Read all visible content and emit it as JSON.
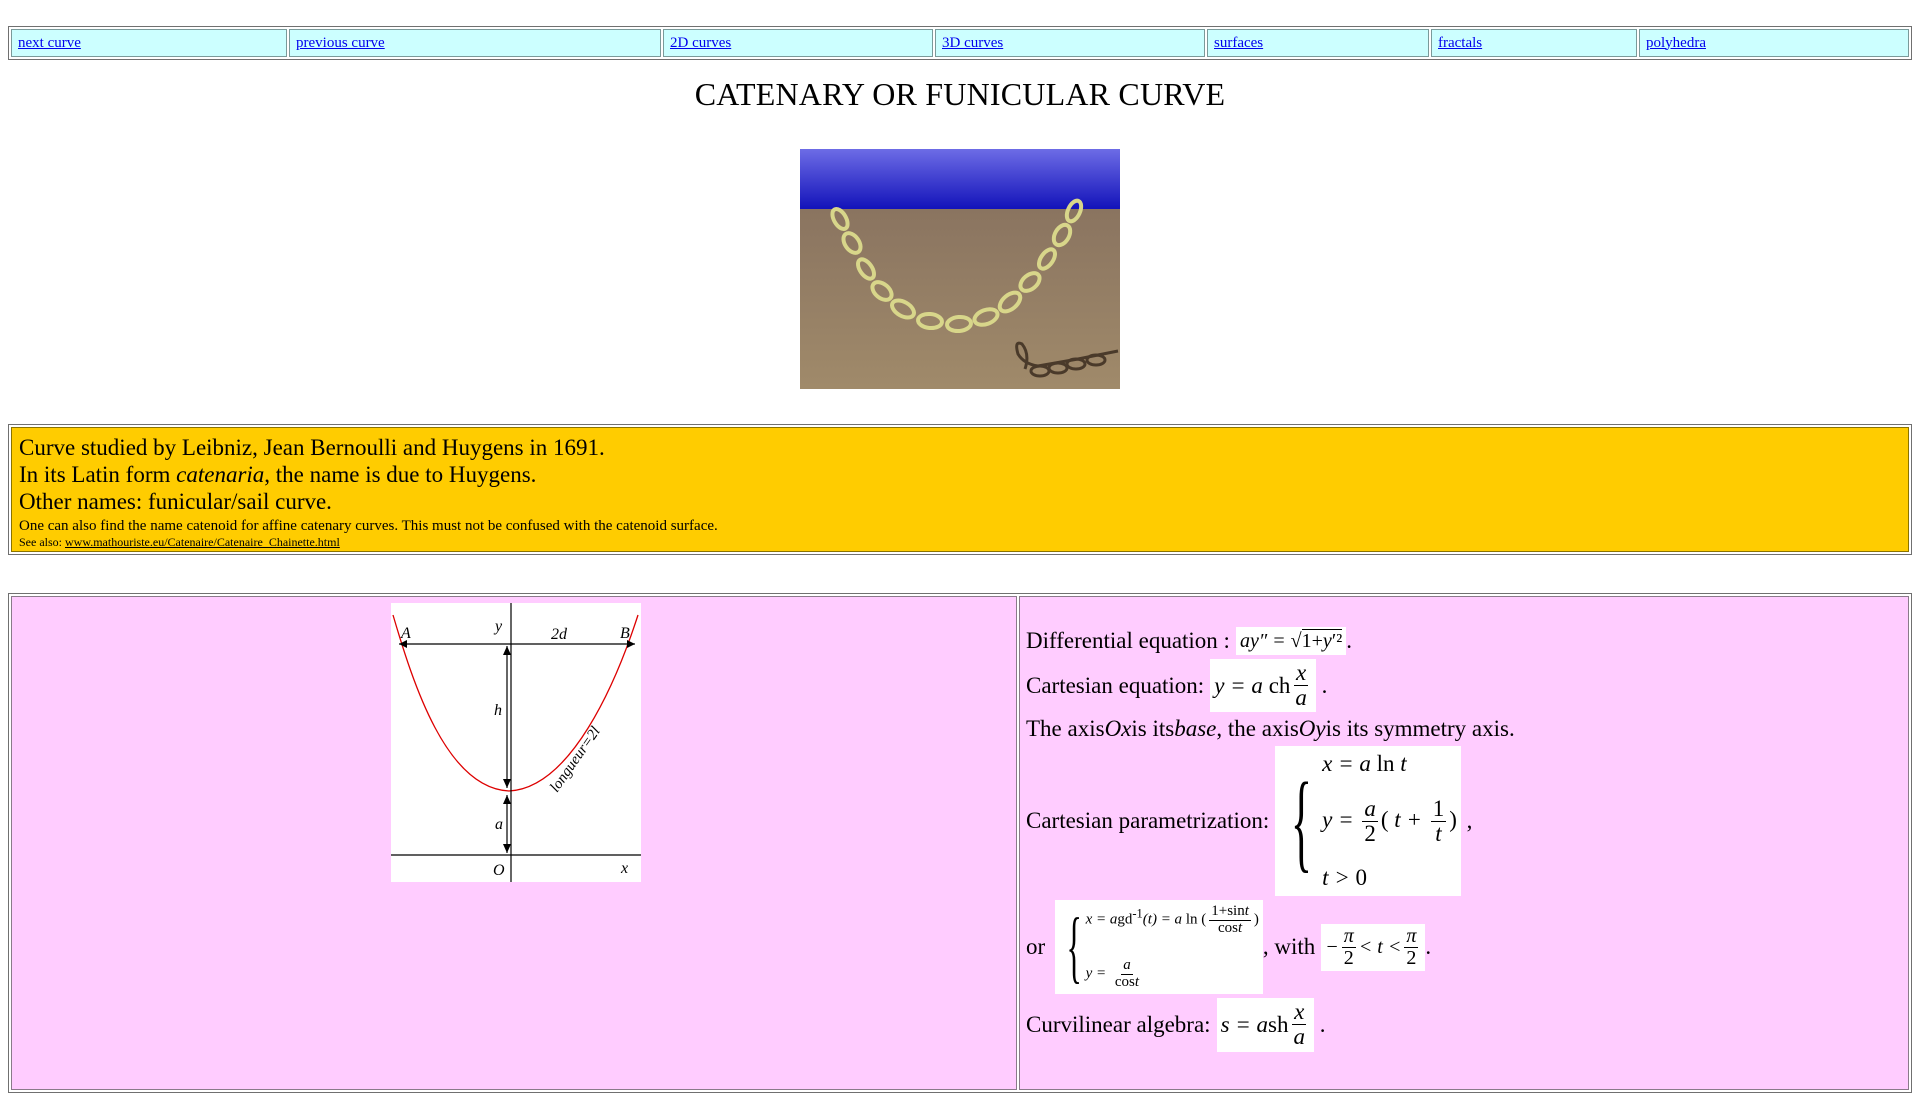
{
  "nav": {
    "items": [
      {
        "label": "next curve"
      },
      {
        "label": "previous curve"
      },
      {
        "label": "2D curves"
      },
      {
        "label": "3D curves"
      },
      {
        "label": "surfaces"
      },
      {
        "label": "fractals"
      },
      {
        "label": "polyhedra"
      }
    ]
  },
  "page_title": "CATENARY OR FUNICULAR CURVE",
  "info": {
    "line1": "Curve studied by Leibniz, Jean Bernoulli and Huygens in 1691.",
    "line2_pre": "In its Latin form ",
    "line2_em": "catenaria",
    "line2_post": ", the name is due to Huygens.",
    "line3": "Other names: funicular/sail curve.",
    "line4": "One can also find the name catenoid for affine catenary curves. This must not be confused with the catenoid surface.",
    "see_also_label": "See also: ",
    "see_also_link": "www.mathouriste.eu/Catenaire/Catenaire_Chainette.html"
  },
  "diagram": {
    "A": "A",
    "B": "B",
    "y": "y",
    "twod": "2d",
    "h": "h",
    "a": "a",
    "O": "O",
    "x": "x",
    "longueur": "longueur=2l"
  },
  "equations": {
    "diff_label": "Differential equation : ",
    "cart_label": "Cartesian equation: ",
    "axis_text": {
      "p1": "The axis ",
      "ox": "Ox",
      "p2": " is its ",
      "base": "base",
      "p3": ", the axis ",
      "oy": "Oy",
      "p4": " is its symmetry axis."
    },
    "param_label": "Cartesian parametrization: ",
    "or_label": "or",
    "with_label": ", with",
    "curv_label": "Curvilinear algebra: "
  },
  "colors": {
    "nav_bg": "#ccffff",
    "info_bg": "#ffcc00",
    "lower_bg": "#ffccff",
    "link": "#0000ee",
    "curve": "#dd0000"
  },
  "images": {
    "chain": "catenary-chain-render"
  }
}
